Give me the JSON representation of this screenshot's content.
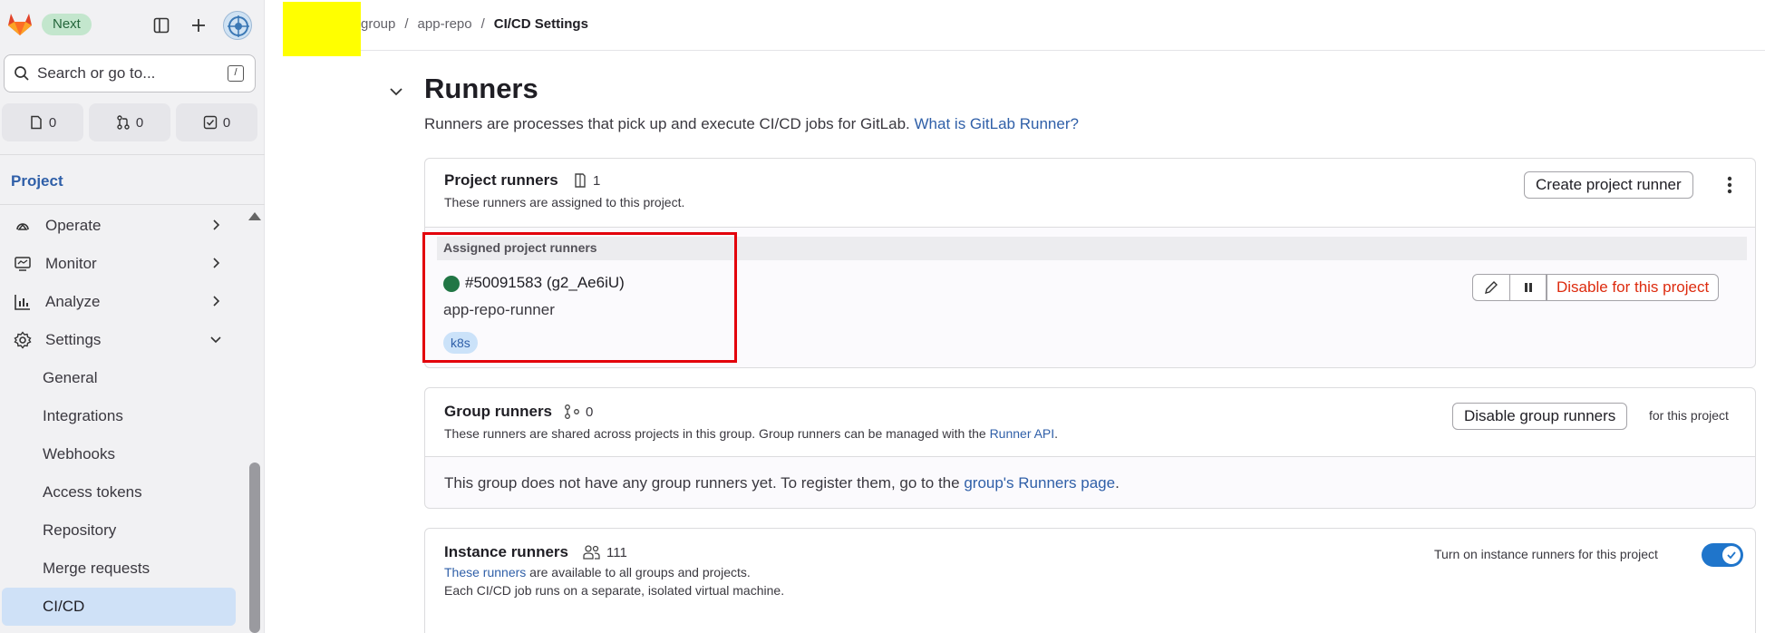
{
  "topbar": {
    "next_badge": "Next",
    "search_placeholder": "Search or go to...",
    "search_shortcut": "/",
    "counters": [
      {
        "icon": "issues-icon",
        "value": "0"
      },
      {
        "icon": "merge-request-icon",
        "value": "0"
      },
      {
        "icon": "todo-icon",
        "value": "0"
      }
    ]
  },
  "sidebar": {
    "section": "Project",
    "items": [
      {
        "label": "Operate",
        "icon": "operate-icon"
      },
      {
        "label": "Monitor",
        "icon": "monitor-icon"
      },
      {
        "label": "Analyze",
        "icon": "analyze-icon"
      },
      {
        "label": "Settings",
        "icon": "settings-icon"
      }
    ],
    "settings_sub": [
      "General",
      "Integrations",
      "Webhooks",
      "Access tokens",
      "Repository",
      "Merge requests",
      "CI/CD"
    ]
  },
  "breadcrumb": [
    "group",
    "app-repo",
    "CI/CD Settings"
  ],
  "page": {
    "title": "Runners",
    "description": "Runners are processes that pick up and execute CI/CD jobs for GitLab.",
    "description_link": "What is GitLab Runner?"
  },
  "project_runners": {
    "title": "Project runners",
    "count": "1",
    "subtitle": "These runners are assigned to this project.",
    "create_button": "Create project runner",
    "assigned_label": "Assigned project runners",
    "runner_id": "#50091583 (g2_Ae6iU)",
    "runner_name": "app-repo-runner",
    "tag": "k8s",
    "disable_button": "Disable for this project",
    "status_color": "#217645"
  },
  "group_runners": {
    "title": "Group runners",
    "count": "0",
    "subtitle": "These runners are shared across projects in this group. Group runners can be managed with the",
    "subtitle_link": "Runner API",
    "subtitle_end": ".",
    "disable_button": "Disable group runners",
    "suffix": "for this project",
    "empty_text": "This group does not have any group runners yet. To register them, go to the",
    "empty_link": "group's Runners page",
    "empty_end": "."
  },
  "instance_runners": {
    "title": "Instance runners",
    "count": "111",
    "line1_link": "These runners",
    "line1_rest": "are available to all groups and projects.",
    "line2": "Each CI/CD job runs on a separate, isolated virtual machine.",
    "toggle_label": "Turn on instance runners for this project",
    "toggle_on": true
  },
  "colors": {
    "accent": "#1f75cb",
    "link": "#2f5fa8",
    "danger": "#dd2b0e",
    "highlight": "#e3000b",
    "redaction": "#ffff00"
  }
}
